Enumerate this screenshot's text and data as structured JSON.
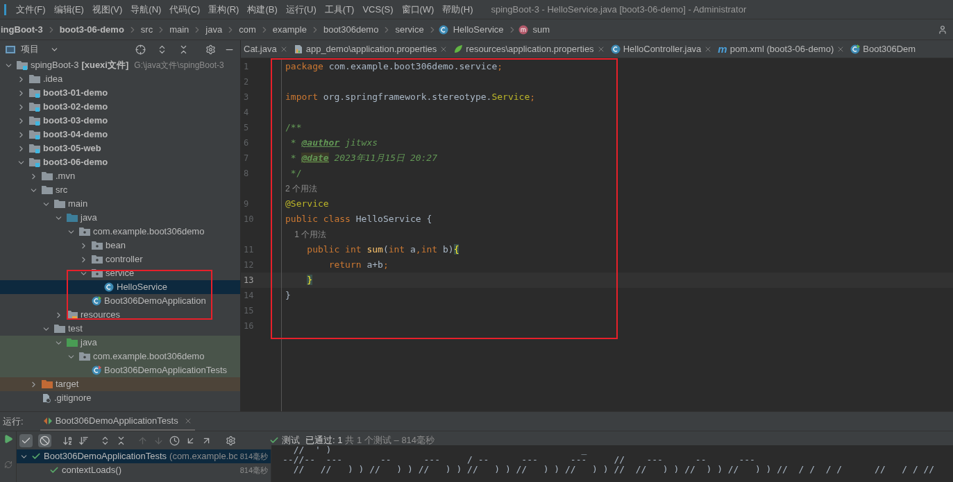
{
  "menu": [
    "文件(F)",
    "编辑(E)",
    "视图(V)",
    "导航(N)",
    "代码(C)",
    "重构(R)",
    "构建(B)",
    "运行(U)",
    "工具(T)",
    "VCS(S)",
    "窗口(W)",
    "帮助(H)"
  ],
  "window": {
    "title": "spingBoot-3 - HelloService.java [boot3-06-demo] - Administrator"
  },
  "breadcrumb": [
    {
      "label": "ingBoot-3",
      "bold": true
    },
    {
      "label": "boot3-06-demo",
      "bold": true
    },
    {
      "label": "src",
      "bold": false
    },
    {
      "label": "main",
      "bold": false
    },
    {
      "label": "java",
      "bold": false
    },
    {
      "label": "com",
      "bold": false
    },
    {
      "label": "example",
      "bold": false
    },
    {
      "label": "boot306demo",
      "bold": false
    },
    {
      "label": "service",
      "bold": false
    },
    {
      "label": "HelloService",
      "bold": false,
      "kind": "class"
    },
    {
      "label": "sum",
      "bold": false,
      "kind": "method"
    }
  ],
  "project_panel": {
    "title": "项目",
    "tree": [
      {
        "label": "spingBoot-3",
        "tag": "[xuexi文件]",
        "path": "G:\\java文件\\spingBoot-3",
        "kind": "module",
        "bold": false,
        "expanded": true,
        "selected": false,
        "children": [
          {
            "label": ".idea",
            "kind": "folder",
            "bold": false,
            "expanded": false,
            "selected": false
          },
          {
            "label": "boot3-01-demo",
            "kind": "module",
            "bold": true,
            "expanded": false,
            "selected": false
          },
          {
            "label": "boot3-02-demo",
            "kind": "module",
            "bold": true,
            "expanded": false,
            "selected": false
          },
          {
            "label": "boot3-03-demo",
            "kind": "module",
            "bold": true,
            "expanded": false,
            "selected": false
          },
          {
            "label": "boot3-04-demo",
            "kind": "module",
            "bold": true,
            "expanded": false,
            "selected": false
          },
          {
            "label": "boot3-05-web",
            "kind": "module",
            "bold": true,
            "expanded": false,
            "selected": false
          },
          {
            "label": "boot3-06-demo",
            "kind": "module",
            "bold": true,
            "expanded": true,
            "selected": false,
            "children": [
              {
                "label": ".mvn",
                "kind": "folder",
                "bold": false,
                "expanded": false,
                "selected": false
              },
              {
                "label": "src",
                "kind": "folder",
                "bold": false,
                "expanded": true,
                "selected": false,
                "children": [
                  {
                    "label": "main",
                    "kind": "folder",
                    "bold": false,
                    "expanded": true,
                    "selected": false,
                    "children": [
                      {
                        "label": "java",
                        "kind": "source",
                        "bold": false,
                        "expanded": true,
                        "selected": false,
                        "children": [
                          {
                            "label": "com.example.boot306demo",
                            "kind": "package",
                            "bold": false,
                            "expanded": true,
                            "selected": false,
                            "children": [
                              {
                                "label": "bean",
                                "kind": "package",
                                "bold": false,
                                "expanded": false,
                                "selected": false
                              },
                              {
                                "label": "controller",
                                "kind": "package",
                                "bold": false,
                                "expanded": false,
                                "selected": false
                              },
                              {
                                "label": "service",
                                "kind": "package",
                                "bold": false,
                                "expanded": true,
                                "selected": false,
                                "children": [
                                  {
                                    "label": "HelloService",
                                    "kind": "class",
                                    "bold": false,
                                    "selected": true
                                  }
                                ]
                              },
                              {
                                "label": "Boot306DemoApplication",
                                "kind": "app",
                                "bold": false,
                                "selected": false
                              }
                            ]
                          }
                        ]
                      },
                      {
                        "label": "resources",
                        "kind": "resources",
                        "bold": false,
                        "expanded": false,
                        "selected": false
                      }
                    ]
                  },
                  {
                    "label": "test",
                    "kind": "folder",
                    "bold": false,
                    "expanded": true,
                    "selected": false,
                    "children": [
                      {
                        "label": "java",
                        "kind": "test-source",
                        "bold": false,
                        "expanded": true,
                        "selected": false,
                        "children": [
                          {
                            "label": "com.example.boot306demo",
                            "kind": "package",
                            "bold": false,
                            "expanded": true,
                            "selected": false,
                            "children": [
                              {
                                "label": "Boot306DemoApplicationTests",
                                "kind": "test-class",
                                "bold": false,
                                "selected": false
                              }
                            ]
                          }
                        ]
                      }
                    ]
                  }
                ]
              },
              {
                "label": "target",
                "kind": "excluded",
                "bold": false,
                "expanded": false,
                "selected": false
              },
              {
                "label": ".gitignore",
                "kind": "file",
                "bold": false,
                "selected": false
              }
            ]
          }
        ]
      }
    ]
  },
  "tabs": [
    {
      "label": "Cat.java",
      "selected": false
    },
    {
      "label": "app_demo\\application.properties",
      "kind": "properties",
      "selected": false
    },
    {
      "label": "resources\\application.properties",
      "kind": "spring",
      "selected": false
    },
    {
      "label": "HelloController.java",
      "kind": "class",
      "selected": false
    },
    {
      "label": "pom.xml (boot3-06-demo)",
      "kind": "maven",
      "glyph": "m",
      "selected": false
    },
    {
      "label": "Boot306Dem",
      "kind": "app",
      "selected": false
    }
  ],
  "editor": {
    "lines": [
      {
        "kind": "code",
        "number": "1",
        "current": false,
        "tokens": [
          {
            "kind": "keyword",
            "text": "package "
          },
          {
            "kind": "plain",
            "text": "com.example.boot306demo.service"
          },
          {
            "kind": "keyword",
            "text": ";"
          }
        ]
      },
      {
        "kind": "code",
        "number": "2",
        "current": false
      },
      {
        "kind": "code",
        "number": "3",
        "current": false,
        "tokens": [
          {
            "kind": "keyword",
            "text": "import "
          },
          {
            "kind": "plain",
            "text": "org.springframework.stereotype."
          },
          {
            "kind": "annotation",
            "text": "Service"
          },
          {
            "kind": "keyword",
            "text": ";"
          }
        ]
      },
      {
        "kind": "code",
        "number": "4",
        "current": false
      },
      {
        "kind": "code",
        "number": "5",
        "current": false,
        "tokens": [
          {
            "kind": "doc",
            "text": "/**"
          }
        ]
      },
      {
        "kind": "code",
        "number": "6",
        "current": false,
        "tokens": [
          {
            "kind": "doc",
            "text": " * "
          },
          {
            "kind": "doctag",
            "text": "@author"
          },
          {
            "kind": "docitalic",
            "text": " jitwxs"
          }
        ]
      },
      {
        "kind": "code",
        "number": "7",
        "current": false,
        "tokens": [
          {
            "kind": "doc",
            "text": " * "
          },
          {
            "kind": "doctag-marked",
            "text": "@date"
          },
          {
            "kind": "docitalic",
            "text": " 2023年11月15日 20:27"
          }
        ]
      },
      {
        "kind": "code",
        "number": "8",
        "current": false,
        "tokens": [
          {
            "kind": "doc",
            "text": " */"
          }
        ]
      },
      {
        "kind": "hint",
        "text": "2 个用法"
      },
      {
        "kind": "code",
        "number": "9",
        "current": false,
        "tokens": [
          {
            "kind": "annotation",
            "text": "@Service"
          }
        ]
      },
      {
        "kind": "code",
        "number": "10",
        "current": false,
        "tokens": [
          {
            "kind": "keyword",
            "text": "public class "
          },
          {
            "kind": "plain",
            "text": "HelloService {"
          }
        ]
      },
      {
        "kind": "hint",
        "text": "    1 个用法"
      },
      {
        "kind": "code",
        "number": "11",
        "current": false,
        "tokens": [
          {
            "kind": "keyword",
            "text": "    public int "
          },
          {
            "kind": "method",
            "text": "sum"
          },
          {
            "kind": "plain",
            "text": "("
          },
          {
            "kind": "keyword",
            "text": "int "
          },
          {
            "kind": "plain",
            "text": "a"
          },
          {
            "kind": "keyword",
            "text": ","
          },
          {
            "kind": "keyword",
            "text": "int "
          },
          {
            "kind": "plain",
            "text": "b)"
          },
          {
            "kind": "brace",
            "text": "{"
          }
        ]
      },
      {
        "kind": "code",
        "number": "12",
        "current": false,
        "tokens": [
          {
            "kind": "keyword",
            "text": "        return "
          },
          {
            "kind": "plain",
            "text": "a+b"
          },
          {
            "kind": "keyword",
            "text": ";"
          }
        ]
      },
      {
        "kind": "code",
        "number": "13",
        "current": true,
        "tokens": [
          {
            "kind": "brace",
            "text": "    }"
          }
        ]
      },
      {
        "kind": "code",
        "number": "14",
        "current": false,
        "tokens": [
          {
            "kind": "plain",
            "text": "}"
          }
        ]
      },
      {
        "kind": "code",
        "number": "15",
        "current": false
      },
      {
        "kind": "code",
        "number": "16",
        "current": false
      }
    ]
  },
  "run_panel": {
    "label": "运行:",
    "tab": "Boot306DemoApplicationTests",
    "status": {
      "prefix": "测试",
      "result": "已通过: 1",
      "detail": "共 1 个测试 – 814毫秒"
    },
    "tests": [
      {
        "label": "Boot306DemoApplicationTests",
        "detail": "(com.example.bc",
        "time": "814毫秒",
        "passed": true,
        "selected": true,
        "children": [
          {
            "label": "contextLoads()",
            "time": "814毫秒",
            "passed": true,
            "selected": false
          }
        ]
      }
    ],
    "console": [
      "  //  ' )                                              _",
      "--//--  ---       --      ---     / --      ---      ---     //    ---      --      ---",
      "  //   //   ) ) //   ) ) //   ) ) //   ) ) //   ) ) //   ) ) //  //   ) ) //  ) ) //   ) ) //  / /  / /      //   / / //"
    ]
  }
}
